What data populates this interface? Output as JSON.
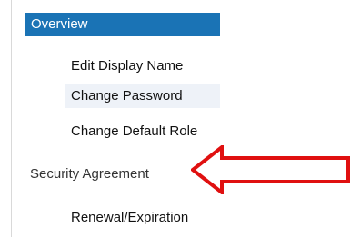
{
  "nav": {
    "header_label": "Overview",
    "items": [
      {
        "label": "Edit Display Name"
      },
      {
        "label": "Change Password"
      },
      {
        "label": "Change Default Role"
      }
    ],
    "section_label": "Security Agreement",
    "after_section": [
      {
        "label": "Renewal/Expiration"
      }
    ]
  },
  "colors": {
    "header_bg": "#1a73b5",
    "header_text": "#ffffff",
    "highlight_bg": "#eef2f8",
    "arrow": "#e01010"
  },
  "annotation": {
    "icon": "red-arrow-icon"
  }
}
